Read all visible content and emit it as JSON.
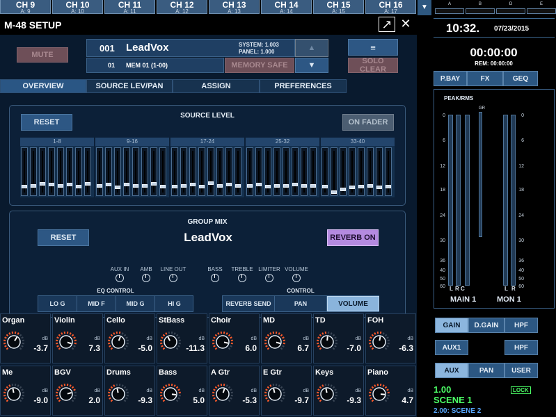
{
  "channel_strip": [
    {
      "ch": "CH 9",
      "a": "A: 9"
    },
    {
      "ch": "CH 10",
      "a": "A: 10"
    },
    {
      "ch": "CH 11",
      "a": "A: 11"
    },
    {
      "ch": "CH 12",
      "a": "A: 12"
    },
    {
      "ch": "CH 13",
      "a": "A: 13"
    },
    {
      "ch": "CH 14",
      "a": "A: 14"
    },
    {
      "ch": "CH 15",
      "a": "A: 15"
    },
    {
      "ch": "CH 16",
      "a": "A: 17"
    }
  ],
  "setup": {
    "title": "M-48 SETUP",
    "mute": "MUTE",
    "memory_number": "001",
    "memory_name": "LeadVox",
    "system_version": "SYSTEM: 1.003",
    "panel_version": "PANEL:  1.000",
    "memory_sub_number": "01",
    "memory_sub_name": "MEM 01 (1-00)",
    "memory_safe": "MEMORY SAFE",
    "menu_icon": "menu-icon",
    "solo_clear": "SOLO CLEAR"
  },
  "tabs": [
    "OVERVIEW",
    "SOURCE LEV/PAN",
    "ASSIGN",
    "PREFERENCES"
  ],
  "source_level": {
    "title": "SOURCE LEVEL",
    "reset": "RESET",
    "on_fader": "ON FADER",
    "groups": [
      {
        "label": "1-8",
        "levels": [
          0.85,
          0.82,
          0.78,
          0.8,
          0.82,
          0.8,
          0.84,
          0.78
        ]
      },
      {
        "label": "9-16",
        "levels": [
          0.82,
          0.8,
          0.86,
          0.8,
          0.82,
          0.82,
          0.78,
          0.84
        ]
      },
      {
        "label": "17-24",
        "levels": [
          0.84,
          0.82,
          0.8,
          0.84,
          0.76,
          0.82,
          0.8,
          0.82
        ]
      },
      {
        "label": "25-32",
        "levels": [
          0.82,
          0.8,
          0.84,
          0.82,
          0.82,
          0.8,
          0.82,
          0.82
        ]
      },
      {
        "label": "33-40",
        "levels": [
          0.84,
          0.98,
          0.92,
          0.86,
          0.84,
          0.82,
          0.86,
          0.84
        ]
      }
    ]
  },
  "group_mix": {
    "title": "GROUP MIX",
    "reset": "RESET",
    "name": "LeadVox",
    "reverb_on": "REVERB ON",
    "knobs": [
      "AUX IN",
      "AMB",
      "LINE OUT",
      "BASS",
      "TREBLE",
      "LIMITER",
      "VOLUME"
    ],
    "eq_control_label": "EQ CONTROL",
    "eq_buttons": [
      "LO G",
      "MID F",
      "MID G",
      "HI G"
    ],
    "control_label": "CONTROL",
    "control_buttons": [
      "REVERB SEND",
      "PAN",
      "VOLUME"
    ]
  },
  "channels_row1": [
    {
      "name": "Organ",
      "db": "dB",
      "value": "-3.7",
      "level": 0.62
    },
    {
      "name": "Violin",
      "db": "dB",
      "value": "7.3",
      "level": 0.9
    },
    {
      "name": "Cello",
      "db": "dB",
      "value": "-5.0",
      "level": 0.58
    },
    {
      "name": "StBass",
      "db": "dB",
      "value": "-11.3",
      "level": 0.4
    },
    {
      "name": "Choir",
      "db": "dB",
      "value": "6.0",
      "level": 0.88
    },
    {
      "name": "MD",
      "db": "dB",
      "value": "6.7",
      "level": 0.89
    },
    {
      "name": "TD",
      "db": "dB",
      "value": "-7.0",
      "level": 0.52
    },
    {
      "name": "FOH",
      "db": "dB",
      "value": "-6.3",
      "level": 0.54
    }
  ],
  "channels_row2": [
    {
      "name": "Me",
      "db": "dB",
      "value": "-9.0",
      "level": 0.46
    },
    {
      "name": "BGV",
      "db": "dB",
      "value": "2.0",
      "level": 0.78
    },
    {
      "name": "Drums",
      "db": "dB",
      "value": "-9.3",
      "level": 0.46
    },
    {
      "name": "Bass",
      "db": "dB",
      "value": "5.0",
      "level": 0.86
    },
    {
      "name": "A Gtr",
      "db": "dB",
      "value": "-5.3",
      "level": 0.57
    },
    {
      "name": "E Gtr",
      "db": "dB",
      "value": "-9.7",
      "level": 0.45
    },
    {
      "name": "Keys",
      "db": "dB",
      "value": "-9.3",
      "level": 0.46
    },
    {
      "name": "Piano",
      "db": "dB",
      "value": "4.7",
      "level": 0.85
    }
  ],
  "right_panel": {
    "scene_letters": [
      "A",
      "B",
      "D",
      "E"
    ],
    "time": "10:32.",
    "date": "07/23/2015",
    "timer": "00:00:00",
    "rem": "REM: 00:00:00",
    "tabs": [
      "P.BAY",
      "FX",
      "GEQ"
    ],
    "peak_rms": "PEAK/RMS",
    "gr": "GR",
    "scale": [
      "0",
      "6",
      "12",
      "18",
      "24",
      "30",
      "36",
      "40",
      "50",
      "60"
    ],
    "main_lr": [
      "L",
      "R",
      "C"
    ],
    "mon_lr": [
      "L",
      "R"
    ],
    "main_label": "MAIN 1",
    "mon_label": "MON 1",
    "gain_buttons": [
      "GAIN",
      "D.GAIN",
      "HPF"
    ],
    "aux1": "AUX1",
    "hpf": "HPF",
    "mode_buttons": [
      "AUX",
      "PAN",
      "USER"
    ],
    "scene_number": "1.00",
    "lock": "LOCK",
    "scene_name": "SCENE 1",
    "next_scene": "2.00: SCENE 2"
  }
}
